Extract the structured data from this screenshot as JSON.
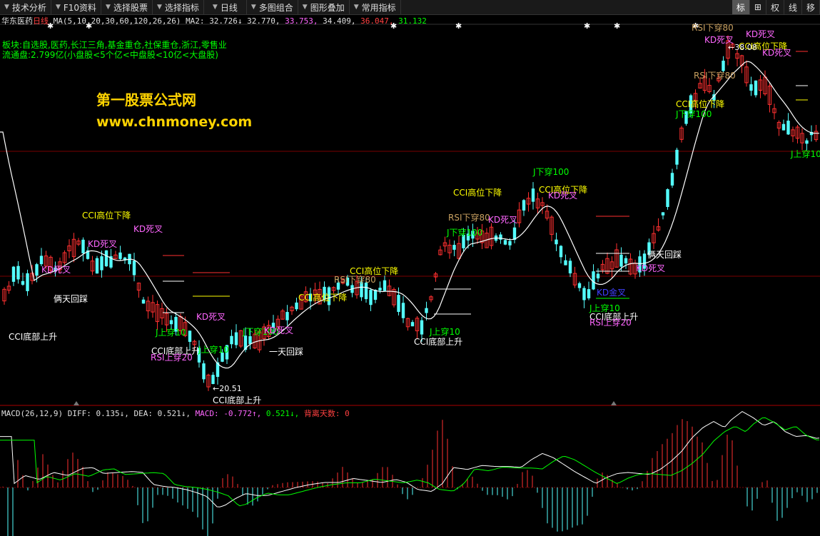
{
  "toolbar": {
    "items": [
      {
        "label": "技术分析",
        "arrow": "▼"
      },
      {
        "label": "F10资料",
        "arrow": "▼"
      },
      {
        "label": "选择股票",
        "arrow": "▼"
      },
      {
        "label": "选择指标",
        "arrow": "▼"
      },
      {
        "label": "日线",
        "arrow": "▼"
      },
      {
        "label": "多图组合",
        "arrow": "▼"
      },
      {
        "label": "图形叠加",
        "arrow": "▼"
      },
      {
        "label": "常用指标",
        "arrow": "▼"
      }
    ],
    "right": [
      "标",
      "⊞",
      "权",
      "线",
      "移"
    ]
  },
  "header": {
    "stock_name": "华东医药",
    "period": "日线",
    "ma_label": "MA(5,10,20,30,60,120,26,26)",
    "ma2_label": "MA2:",
    "ma_values": [
      {
        "text": "32.726↓",
        "color": "#e0e0e0"
      },
      {
        "text": "32.770,",
        "color": "#e0e0e0"
      },
      {
        "text": "33.753,",
        "color": "#ff66ff"
      },
      {
        "text": "34.409,",
        "color": "#e0e0e0"
      },
      {
        "text": "36.047,",
        "color": "#ff4040"
      },
      {
        "text": "31.132",
        "color": "#00ff00"
      }
    ]
  },
  "info": {
    "sector": "板块:自选股,医药,长江三角,基金重仓,社保重仓,浙江,零售业",
    "float": "流通盘:2.799亿(小盘股<5个亿<中盘股<10亿<大盘股)"
  },
  "watermark": {
    "title": "第一股票公式网",
    "url": "www.chnmoney.com"
  },
  "price_marks": {
    "high": "38.08",
    "low": "20.51"
  },
  "macd": {
    "label": "MACD(26,12,9)",
    "diff_label": "DIFF:",
    "diff": "0.135↓,",
    "dea_label": "DEA:",
    "dea": "0.521↓,",
    "macd_label": "MACD:",
    "macd_value": "-0.772↑,",
    "dea2": "0.521↓,",
    "divergence_label": "背离天数:",
    "divergence_value": "0"
  },
  "annotations": [
    {
      "text": "CCI底部上升",
      "color": "#ffffff"
    },
    {
      "text": "KD死叉",
      "color": "#ff66ff"
    },
    {
      "text": "俩天回踩",
      "color": "#ffffff"
    },
    {
      "text": "CCI高位下降",
      "color": "#ffff00"
    },
    {
      "text": "KD死叉",
      "color": "#ff66ff"
    },
    {
      "text": "KD死叉",
      "color": "#ff66ff"
    },
    {
      "text": "J上穿10",
      "color": "#00ff00"
    },
    {
      "text": "KD死叉",
      "color": "#ff66ff"
    },
    {
      "text": "CCI底部上升",
      "color": "#ffffff"
    },
    {
      "text": "J上穿10",
      "color": "#00ff00"
    },
    {
      "text": "RSI上穿20",
      "color": "#ff66ff"
    },
    {
      "text": "CCI底部上升",
      "color": "#ffffff"
    },
    {
      "text": "J下穿100",
      "color": "#00ff00"
    },
    {
      "text": "KD死叉",
      "color": "#ff66ff"
    },
    {
      "text": "一天回踩",
      "color": "#ffffff"
    },
    {
      "text": "CCI高位下降",
      "color": "#ffff00"
    },
    {
      "text": "RSI下穿80",
      "color": "#c8a060"
    },
    {
      "text": "CCI高位下降",
      "color": "#ffff00"
    },
    {
      "text": "CCI底部上升",
      "color": "#ffffff"
    },
    {
      "text": "J上穿10",
      "color": "#00ff00"
    },
    {
      "text": "CCI高位下降",
      "color": "#ffff00"
    },
    {
      "text": "RSI下穿80",
      "color": "#c8a060"
    },
    {
      "text": "J下穿100",
      "color": "#00ff00"
    },
    {
      "text": "KD死叉",
      "color": "#ff66ff"
    },
    {
      "text": "J下穿100",
      "color": "#00ff00"
    },
    {
      "text": "CCI高位下降",
      "color": "#ffff00"
    },
    {
      "text": "KD死叉",
      "color": "#ff66ff"
    },
    {
      "text": "俩天回踩",
      "color": "#ffffff"
    },
    {
      "text": "KD死叉",
      "color": "#ff66ff"
    },
    {
      "text": "KD金叉",
      "color": "#4040ff"
    },
    {
      "text": "J上穿10",
      "color": "#00ff00"
    },
    {
      "text": "CCI底部上升",
      "color": "#ffffff"
    },
    {
      "text": "RSI上穿20",
      "color": "#ff66ff"
    },
    {
      "text": "CCI高位下降",
      "color": "#ffff00"
    },
    {
      "text": "J下穿100",
      "color": "#00ff00"
    },
    {
      "text": "RSI下穿80",
      "color": "#c8a060"
    },
    {
      "text": "KD死叉",
      "color": "#ff66ff"
    },
    {
      "text": "RSI下穿80",
      "color": "#c8a060"
    },
    {
      "text": "KD死叉",
      "color": "#ff66ff"
    },
    {
      "text": "CCI高位下降",
      "color": "#ffff00"
    },
    {
      "text": "KD死叉",
      "color": "#ff66ff"
    },
    {
      "text": "J上穿10",
      "color": "#00ff00"
    }
  ],
  "colors": {
    "up": "#ff3030",
    "down": "#54ffff",
    "ma": "#ffffff",
    "grid": "#7a0000",
    "dea": "#00ff00",
    "macd_up": "#ff3030",
    "macd_down": "#54ffff"
  }
}
